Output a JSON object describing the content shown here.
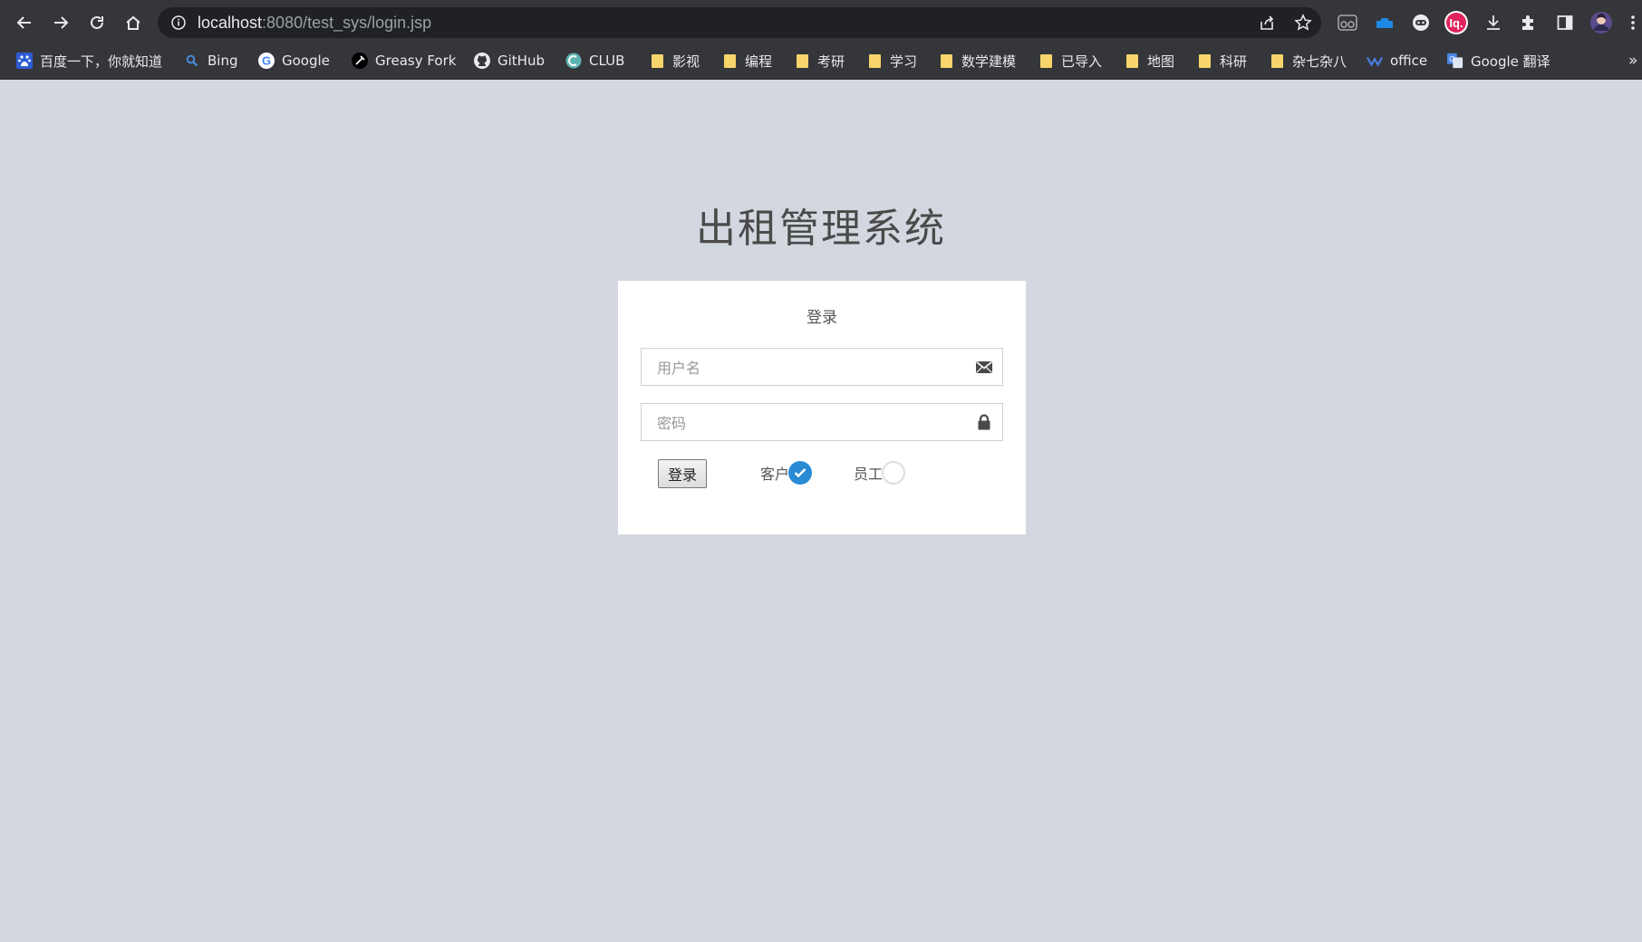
{
  "browser": {
    "url_host": "localhost",
    "url_rest": ":8080/test_sys/login.jsp",
    "bookmarks": [
      {
        "label": "百度一下，你就知道",
        "icon": "baidu-icon"
      },
      {
        "label": "Bing",
        "icon": "bing-search-icon"
      },
      {
        "label": "Google",
        "icon": "google-icon"
      },
      {
        "label": "Greasy Fork",
        "icon": "greasyfork-icon"
      },
      {
        "label": "GitHub",
        "icon": "github-icon"
      },
      {
        "label": "CLUB",
        "icon": "club-icon"
      },
      {
        "label": "影视",
        "icon": "folder-icon"
      },
      {
        "label": "编程",
        "icon": "folder-icon"
      },
      {
        "label": "考研",
        "icon": "folder-icon"
      },
      {
        "label": "学习",
        "icon": "folder-icon"
      },
      {
        "label": "数学建模",
        "icon": "folder-icon"
      },
      {
        "label": "已导入",
        "icon": "folder-icon"
      },
      {
        "label": "地图",
        "icon": "folder-icon"
      },
      {
        "label": "科研",
        "icon": "folder-icon"
      },
      {
        "label": "杂七杂八",
        "icon": "folder-icon"
      },
      {
        "label": "office",
        "icon": "office-icon"
      },
      {
        "label": "Google 翻译",
        "icon": "google-translate-icon"
      }
    ],
    "overflow": "»"
  },
  "page": {
    "title": "出租管理系统"
  },
  "login": {
    "heading": "登录",
    "username_placeholder": "用户名",
    "password_placeholder": "密码",
    "submit_label": "登录",
    "roles": [
      {
        "label": "客户",
        "checked": true
      },
      {
        "label": "员工",
        "checked": false
      }
    ]
  },
  "colors": {
    "page_background": "#d3d7df",
    "radio_checked": "#2a8bd5",
    "browser_chrome": "#35363a"
  }
}
